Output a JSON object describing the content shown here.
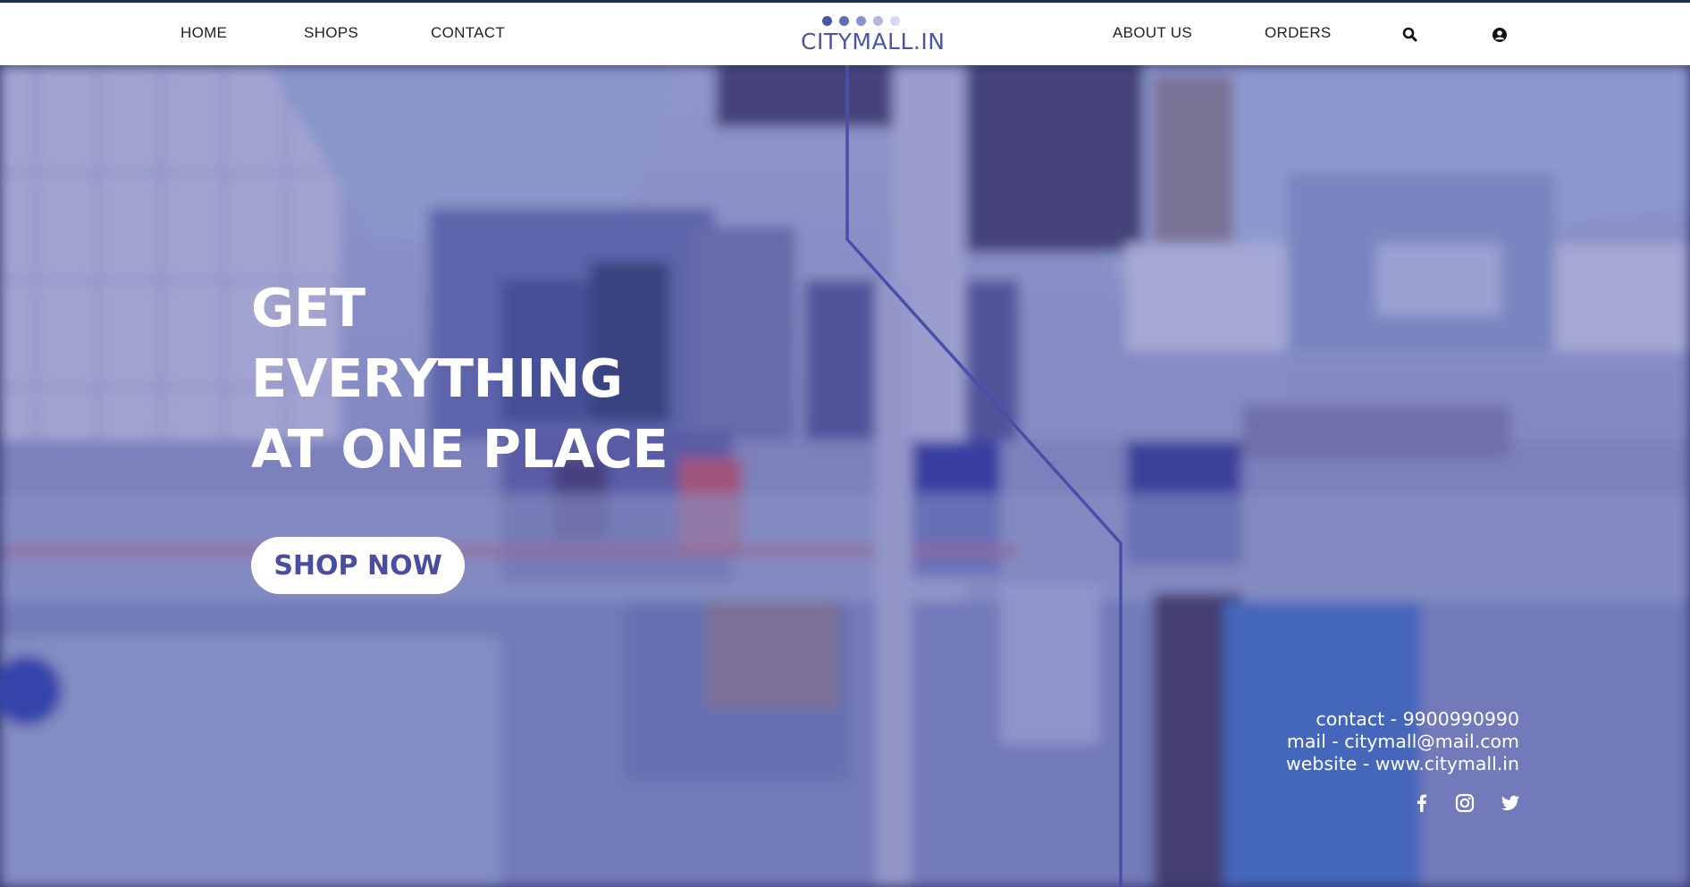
{
  "nav": {
    "left_links": [
      "HOME",
      "SHOPS",
      "CONTACT"
    ],
    "right_links": [
      "ABOUT US",
      "ORDERS"
    ],
    "logo_text": "CITYMALL.IN",
    "logo_dot_colors": [
      "#4a55a2",
      "#626cb3",
      "#8a92c9",
      "#b2b7dc",
      "#d6d9ee"
    ],
    "icons": [
      "search-icon",
      "user-circle-icon"
    ]
  },
  "hero": {
    "headline": [
      "GET",
      "EVERYTHING",
      "AT ONE PLACE"
    ],
    "cta_label": "SHOP NOW"
  },
  "contact": {
    "phone": "contact - 9900990990",
    "mail": "mail - citymall@mail.com",
    "website": "website - www.citymall.in"
  },
  "social_icons": [
    "facebook-icon",
    "instagram-icon",
    "twitter-icon"
  ],
  "colors": {
    "accent": "#4a55a2",
    "overlay_tint": "#5b5fb0",
    "line_accent": "#4a4ea8"
  }
}
